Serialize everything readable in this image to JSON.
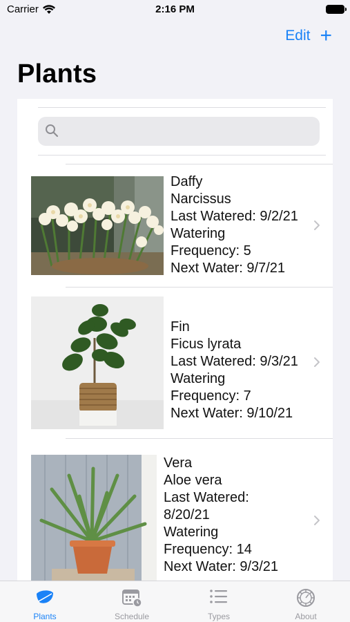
{
  "status_bar": {
    "carrier": "Carrier",
    "time": "2:16 PM"
  },
  "nav": {
    "edit_label": "Edit",
    "add_label": "+"
  },
  "page": {
    "title": "Plants"
  },
  "search": {
    "placeholder": ""
  },
  "plants": [
    {
      "name": "Daffy",
      "species": "Narcissus",
      "last_watered_line": "Last Watered: 9/2/21",
      "freq_label": "Watering",
      "freq_line": "Frequency: 5",
      "next_line": "Next Water: 9/7/21"
    },
    {
      "name": "Fin",
      "species": "Ficus lyrata",
      "last_watered_line": "Last Watered: 9/3/21",
      "freq_label": "Watering",
      "freq_line": "Frequency: 7",
      "next_line": "Next Water: 9/10/21"
    },
    {
      "name": "Vera",
      "species": "Aloe vera",
      "last_watered_label": "Last Watered:",
      "last_watered_date": "8/20/21",
      "freq_label": "Watering",
      "freq_line": "Frequency: 14",
      "next_line": "Next Water: 9/3/21"
    }
  ],
  "tabs": [
    {
      "label": "Plants",
      "icon": "leaf-icon",
      "active": true
    },
    {
      "label": "Schedule",
      "icon": "calendar-clock-icon",
      "active": false
    },
    {
      "label": "Types",
      "icon": "list-icon",
      "active": false
    },
    {
      "label": "About",
      "icon": "gear-icon",
      "active": false
    }
  ],
  "colors": {
    "accent": "#1a82f7",
    "background": "#f2f2f7",
    "inactive": "#9a9aa0"
  }
}
